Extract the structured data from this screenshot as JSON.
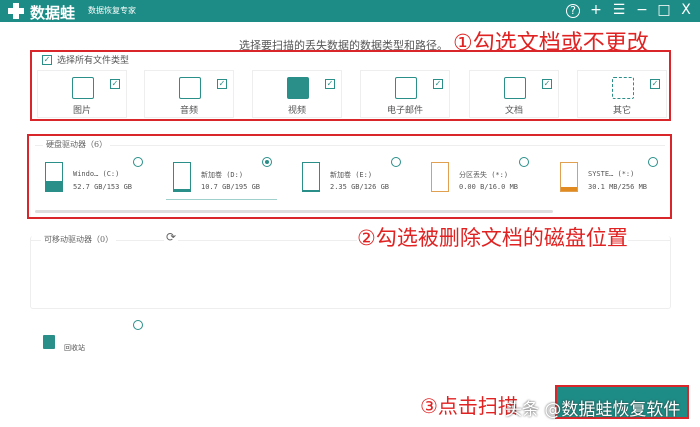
{
  "app": {
    "name": "数据蛙",
    "subtitle": "数据恢复专家"
  },
  "titlebar": {
    "help": "?",
    "add": "+",
    "menu": "☰",
    "minimize": "−",
    "maximize": "□",
    "close": "X"
  },
  "instruction": "选择要扫描的丢失数据的数据类型和路径。",
  "annotations": {
    "step1": "①勾选文档或不更改",
    "step2": "②勾选被删除文档的磁盘位置",
    "step3": "③点击扫描"
  },
  "file_types": {
    "select_all": "选择所有文件类型",
    "select_all_checked": true,
    "items": [
      {
        "label": "图片",
        "icon": "image-icon",
        "checked": true
      },
      {
        "label": "音频",
        "icon": "audio-icon",
        "checked": true
      },
      {
        "label": "视频",
        "icon": "video-icon",
        "checked": true
      },
      {
        "label": "电子邮件",
        "icon": "email-icon",
        "checked": true
      },
      {
        "label": "文档",
        "icon": "document-icon",
        "checked": true
      },
      {
        "label": "其它",
        "icon": "other-icon",
        "checked": true
      }
    ]
  },
  "hard_drives": {
    "label": "硬盘驱动器（6）",
    "items": [
      {
        "name": "Windo… (C:)",
        "size": "52.7 GB/153 GB",
        "used": 0.34,
        "color": "#2a8f89",
        "selected": false
      },
      {
        "name": "新加卷 (D:)",
        "size": "10.7 GB/195 GB",
        "used": 0.05,
        "color": "#2a8f89",
        "selected": true
      },
      {
        "name": "新加卷 (E:)",
        "size": "2.35 GB/126 GB",
        "used": 0.02,
        "color": "#2a8f89",
        "selected": false
      },
      {
        "name": "分区丢失 (*:)",
        "size": "0.00  B/16.0 MB",
        "used": 0,
        "color": "#e0a050",
        "selected": false
      },
      {
        "name": "SYSTE… (*:)",
        "size": "30.1 MB/256 MB",
        "used": 0.12,
        "color": "#e08a20",
        "selected": false
      }
    ]
  },
  "removable": {
    "label": "可移动驱动器（0）"
  },
  "recycle_bin": {
    "label": "回收站"
  },
  "watermark": "头条 @数据蛙恢复软件"
}
